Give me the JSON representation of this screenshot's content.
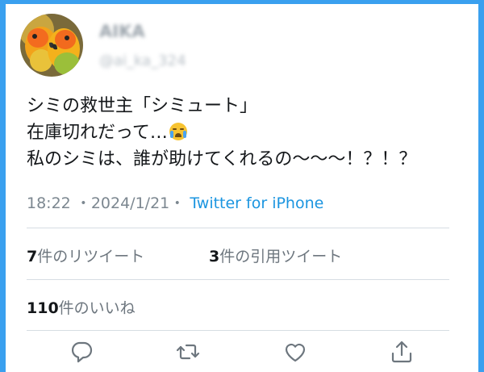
{
  "user": {
    "name": "AIKA",
    "handle": "@ai_ka_324"
  },
  "tweet": {
    "lines": [
      "シミの救世主「シミュート」",
      "在庫切れだって…",
      "私のシミは、誰が助けてくれるの〜〜〜！？！？"
    ],
    "emoji": "loudly-crying-face"
  },
  "meta": {
    "time": "18:22",
    "separator": "・",
    "date": "2024/1/21",
    "source": "Twitter for iPhone"
  },
  "stats": {
    "retweets_count": "7",
    "retweets_label": "件のリツイート",
    "quotes_count": "3",
    "quotes_label": "件の引用ツイート",
    "likes_count": "110",
    "likes_label": "件のいいね"
  },
  "actions": [
    "reply-icon",
    "retweet-icon",
    "like-icon",
    "share-icon"
  ],
  "colors": {
    "frame": "#3aa0ef",
    "link": "#1b95e0",
    "text": "#14171a",
    "muted": "#7c8790"
  }
}
